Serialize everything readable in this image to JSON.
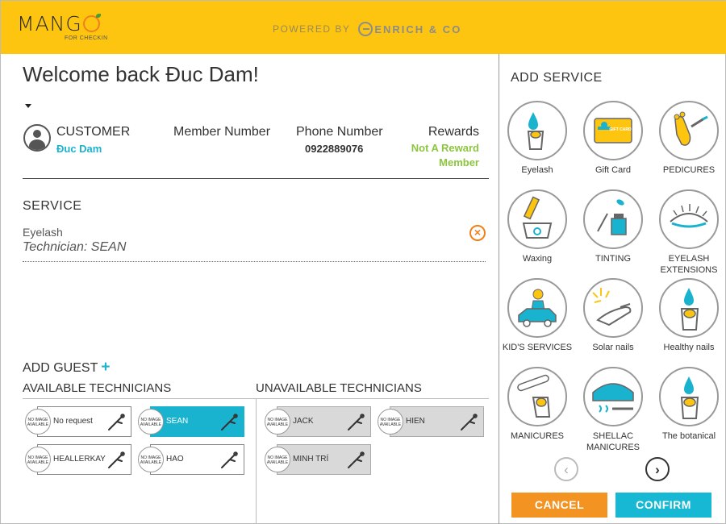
{
  "header": {
    "logo_text": "MANGO",
    "logo_sub": "FOR CHECKIN",
    "powered_by": "POWERED BY",
    "brand": "ENRICH & CO"
  },
  "welcome": "Welcome back Đuc Dam!",
  "customer": {
    "label": "CUSTOMER",
    "name": "Đuc Dam",
    "member_label": "Member Number",
    "phone_label": "Phone Number",
    "phone": "0922889076",
    "rewards_label": "Rewards",
    "rewards_value": "Not A Reward Member"
  },
  "service": {
    "title": "SERVICE",
    "selected": {
      "name": "Eyelash",
      "technician": "Technician: SEAN"
    }
  },
  "add_guest": {
    "label": "ADD GUEST",
    "icon": "plus-icon"
  },
  "technicians": {
    "available_title": "AVAILABLE TECHNICIANS",
    "unavailable_title": "UNAVAILABLE TECHNICIANS",
    "no_image": "NO IMAGE AVAILABLE",
    "available": [
      {
        "name": "No request",
        "selected": false
      },
      {
        "name": "SEAN",
        "selected": true
      },
      {
        "name": "HEALLERKAY",
        "selected": false
      },
      {
        "name": "HAO",
        "selected": false
      }
    ],
    "unavailable": [
      {
        "name": "JACK"
      },
      {
        "name": "HIEN"
      },
      {
        "name": "MINH TRÍ"
      }
    ]
  },
  "add_service": {
    "title": "ADD SERVICE",
    "items": [
      {
        "label": "Eyelash",
        "icon": "eyelash-drop-icon"
      },
      {
        "label": "Gift Card",
        "icon": "gift-card-icon"
      },
      {
        "label": "PEDICURES",
        "icon": "foot-icon"
      },
      {
        "label": "Waxing",
        "icon": "wax-icon"
      },
      {
        "label": "TINTING",
        "icon": "tint-bottle-icon"
      },
      {
        "label": "EYELASH EXTENSIONS",
        "icon": "eye-lash-icon"
      },
      {
        "label": "KID'S SERVICES",
        "icon": "kids-car-icon"
      },
      {
        "label": "Solar nails",
        "icon": "sun-hand-icon"
      },
      {
        "label": "Healthy nails",
        "icon": "finger-drop-icon"
      },
      {
        "label": "MANICURES",
        "icon": "nail-file-icon"
      },
      {
        "label": "SHELLAC MANICURES",
        "icon": "uv-lamp-icon"
      },
      {
        "label": "The botanical",
        "icon": "finger-drop-icon"
      }
    ],
    "gift_card_text": "GIFT CARD",
    "cancel": "CANCEL",
    "confirm": "CONFIRM"
  },
  "colors": {
    "header_yellow": "#fdc50f",
    "accent_cyan": "#1ab3cf",
    "reward_green": "#8cc63f",
    "cancel_orange": "#f39322",
    "confirm_cyan": "#17b8d4"
  }
}
